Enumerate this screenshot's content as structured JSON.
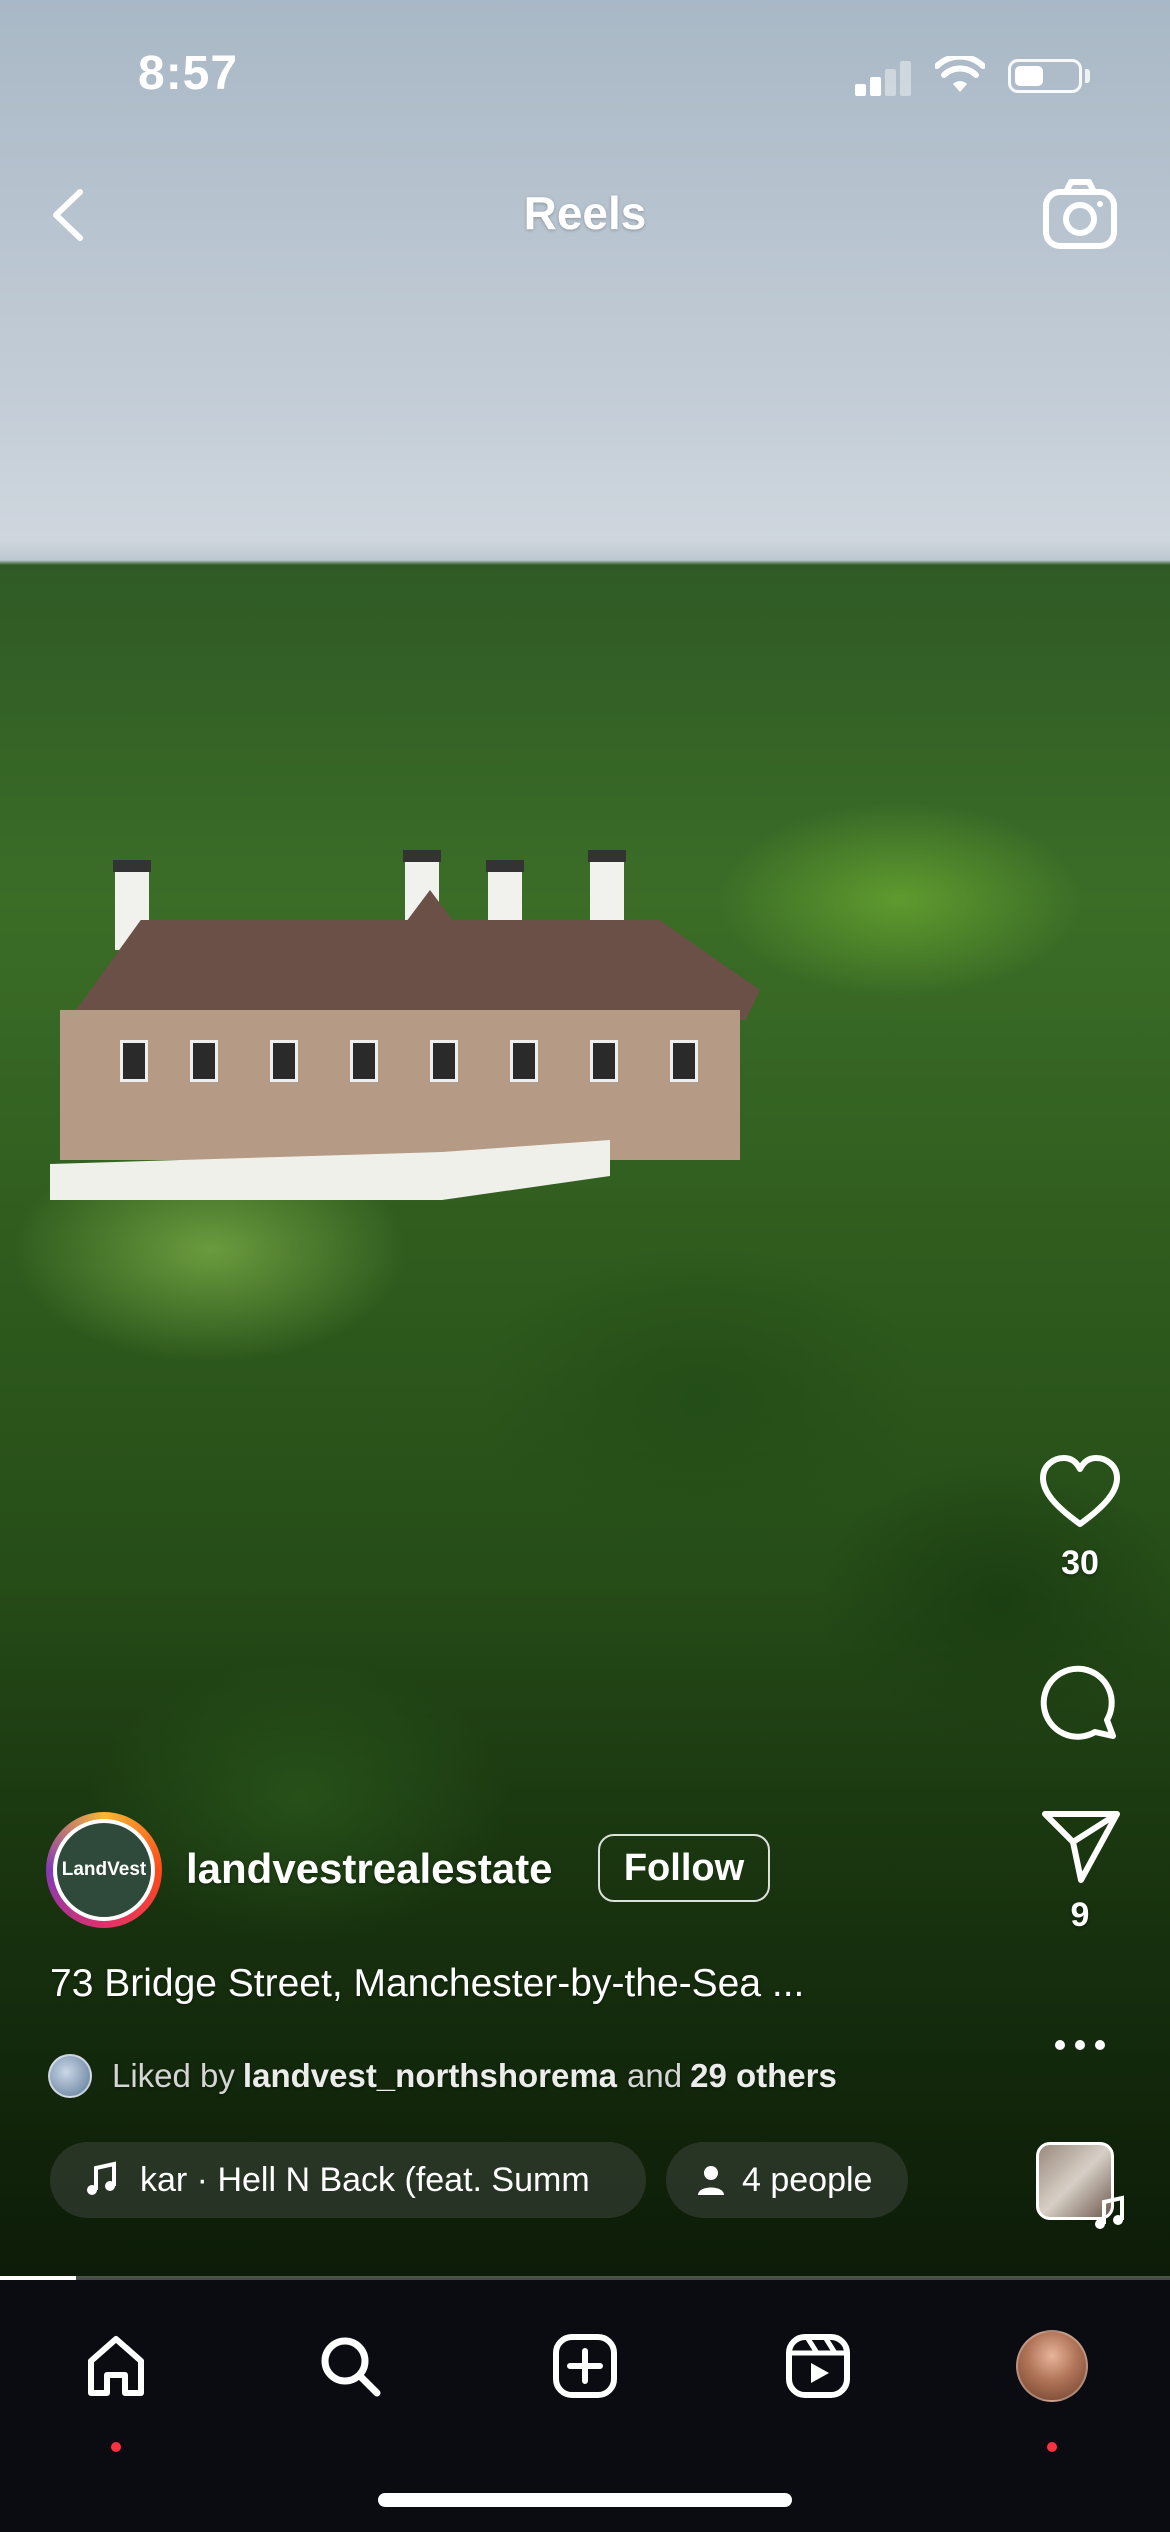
{
  "status_bar": {
    "time": "8:57"
  },
  "header": {
    "title": "Reels"
  },
  "actions": {
    "like_count": "30",
    "share_count": "9"
  },
  "post": {
    "avatar_text": "LandVest",
    "username": "landvestrealestate",
    "follow_label": "Follow",
    "caption": "73 Bridge Street, Manchester-by-the-Sea ...",
    "liked_prefix": "Liked by ",
    "liked_user": "landvest_northshorema",
    "liked_middle": " and ",
    "liked_others": "29 others",
    "music_track": "kar · Hell N Back (feat. Summ",
    "people_label": "4 people"
  },
  "progress": {
    "fraction": 0.065
  },
  "colors": {
    "notification_dot": "#ff3040",
    "tab_bar_bg": "#0b0c11"
  },
  "tabs": [
    {
      "icon": "home-icon",
      "notification": true
    },
    {
      "icon": "search-icon",
      "notification": false
    },
    {
      "icon": "create-icon",
      "notification": false
    },
    {
      "icon": "reels-icon",
      "notification": false
    },
    {
      "icon": "profile-avatar",
      "notification": true
    }
  ]
}
